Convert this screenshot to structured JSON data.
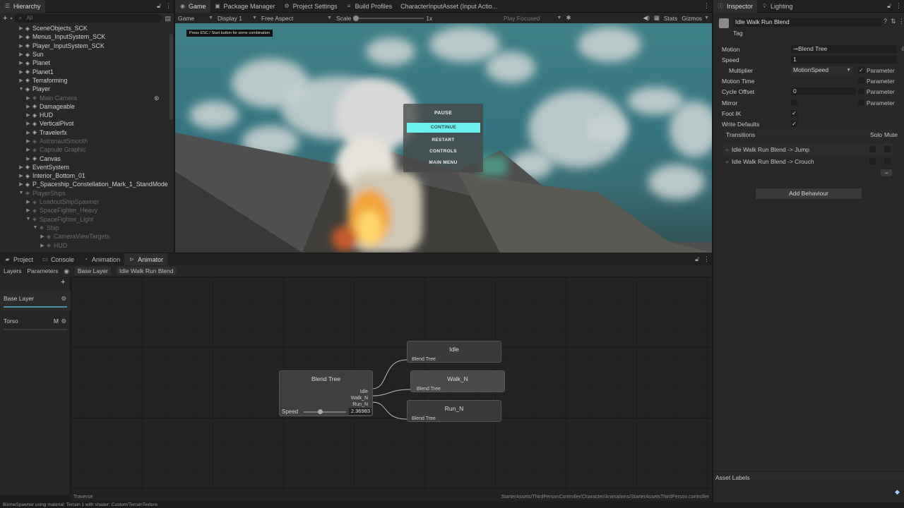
{
  "hierarchy": {
    "tab_label": "Hierarchy",
    "search_placeholder": "All",
    "items": [
      {
        "label": "SceneObjects_SCK",
        "indent": 1,
        "dim": false
      },
      {
        "label": "Menus_InputSystem_SCK",
        "indent": 1,
        "dim": false
      },
      {
        "label": "Player_InputSystem_SCK",
        "indent": 1,
        "dim": false
      },
      {
        "label": "Sun",
        "indent": 1,
        "dim": false
      },
      {
        "label": "Planet",
        "indent": 1,
        "dim": false
      },
      {
        "label": "Planet1",
        "indent": 1,
        "dim": false
      },
      {
        "label": "Terraforming",
        "indent": 1,
        "dim": false
      },
      {
        "label": "Player",
        "indent": 1,
        "dim": false
      },
      {
        "label": "Main Camera",
        "indent": 2,
        "dim": true
      },
      {
        "label": "Damageable",
        "indent": 2,
        "dim": false
      },
      {
        "label": "HUD",
        "indent": 2,
        "dim": false
      },
      {
        "label": "VerticalPivot",
        "indent": 2,
        "dim": false
      },
      {
        "label": "Travelerfx",
        "indent": 2,
        "dim": false
      },
      {
        "label": "AstronautSmooth",
        "indent": 2,
        "dim": true
      },
      {
        "label": "Capsule Graphic",
        "indent": 2,
        "dim": true
      },
      {
        "label": "Canvas",
        "indent": 2,
        "dim": false
      },
      {
        "label": "EventSystem",
        "indent": 1,
        "dim": false
      },
      {
        "label": "Interior_Bottom_01",
        "indent": 1,
        "dim": false
      },
      {
        "label": "P_Spaceship_Constellation_Mark_1_StandMode",
        "indent": 1,
        "dim": false
      },
      {
        "label": "PlayerShips",
        "indent": 1,
        "dim": true
      },
      {
        "label": "LoadoutShipSpawner",
        "indent": 2,
        "dim": true
      },
      {
        "label": "SpaceFighter_Heavy",
        "indent": 2,
        "dim": true
      },
      {
        "label": "SpaceFighter_Light",
        "indent": 2,
        "dim": true
      },
      {
        "label": "Ship",
        "indent": 3,
        "dim": true
      },
      {
        "label": "CameraViewTargets",
        "indent": 4,
        "dim": true
      },
      {
        "label": "HUD",
        "indent": 4,
        "dim": true
      }
    ]
  },
  "top_tabs": {
    "game": "Game",
    "package_manager": "Package Manager",
    "project_settings": "Project Settings",
    "build_profiles": "Build Profiles",
    "input_asset": "CharacterInputAsset (Input Actio..."
  },
  "game_toolbar": {
    "mode": "Game",
    "display": "Display 1",
    "aspect": "Free Aspect",
    "scale_label": "Scale",
    "scale_value": "1x",
    "play_focused": "Play Focused",
    "stats": "Stats",
    "gizmos": "Gizmos"
  },
  "game_view": {
    "hint": "Press ESC / Start button for some combination",
    "pause_menu": {
      "title": "PAUSE",
      "items": [
        "CONTINUE",
        "RESTART",
        "CONTROLS",
        "MAIN MENU"
      ]
    }
  },
  "inspector": {
    "tab_label": "Inspector",
    "lighting_tab": "Lighting",
    "object_name": "Idle Walk Run Blend",
    "tag_label": "Tag",
    "motion_label": "Motion",
    "motion_value": "⊸Blend Tree",
    "speed_label": "Speed",
    "speed_value": "1",
    "multiplier_label": "Multiplier",
    "multiplier_value": "MotionSpeed",
    "motion_time_label": "Motion Time",
    "cycle_offset_label": "Cycle Offset",
    "cycle_offset_value": "0",
    "mirror_label": "Mirror",
    "foot_ik_label": "Foot IK",
    "write_defaults_label": "Write Defaults",
    "parameter_label": "Parameter",
    "transitions_label": "Transitions",
    "solo_label": "Solo",
    "mute_label": "Mute",
    "transitions": [
      "Idle Walk Run Blend -> Jump",
      "Idle Walk Run Blend -> Crouch"
    ],
    "add_behaviour": "Add Behaviour",
    "asset_labels": "Asset Labels"
  },
  "animator": {
    "tabs": [
      "Project",
      "Console",
      "Animation",
      "Animator"
    ],
    "sub_tabs": {
      "layers": "Layers",
      "parameters": "Parameters"
    },
    "breadcrumb": [
      "Base Layer",
      "Idle Walk Run Blend"
    ],
    "layers": [
      {
        "name": "Base Layer",
        "badge": ""
      },
      {
        "name": "Torso",
        "badge": "M"
      }
    ],
    "blend_tree": {
      "title": "Blend Tree",
      "outputs": [
        "Idle",
        "Walk_N",
        "Run_N"
      ],
      "param_label": "Speed",
      "param_value": "2.36983",
      "slider_fraction": 0.38
    },
    "child_nodes": [
      {
        "title": "Idle",
        "sub": "Blend Tree"
      },
      {
        "title": "Walk_N",
        "sub": "Blend Tree"
      },
      {
        "title": "Run_N",
        "sub": "Blend Tree"
      }
    ],
    "footer_left": "Traverse",
    "footer_path": "StarterAssets/ThirdPersonController/Character/Animations/StarterAssetsThirdPerson.controller"
  },
  "status_bar": "BiomeSpawner using material: Terrain 1 with shader: Custom/TerrainTexture"
}
